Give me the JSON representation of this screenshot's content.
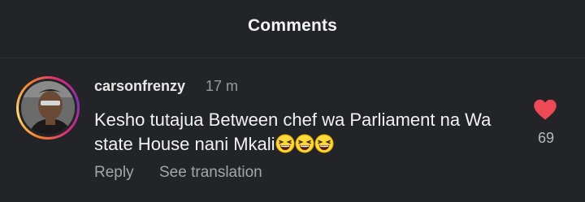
{
  "header": {
    "title": "Comments"
  },
  "comment": {
    "username": "carsonfrenzy",
    "time": "17 m",
    "text": "Kesho tutajua Between chef wa Parliament na Wa state House nani Mkali",
    "emojis": [
      "grinning-squinting-face",
      "grinning-squinting-face",
      "grinning-squinting-face"
    ],
    "likes": "69",
    "liked": true
  },
  "actions": {
    "reply": "Reply",
    "translate": "See translation"
  },
  "colors": {
    "background": "#232428",
    "heart": "#ed4956",
    "secondary_text": "#a4a5aa"
  }
}
